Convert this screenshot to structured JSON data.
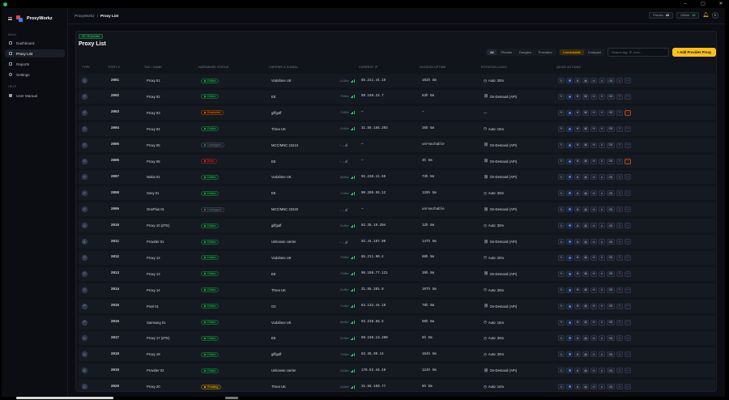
{
  "app": {
    "brand": "ProxyWorkz"
  },
  "window": {
    "controls": [
      "–",
      "▢",
      "✕"
    ]
  },
  "sidebar": {
    "main_label": "MAIN",
    "help_label": "HELP",
    "items": [
      {
        "label": "Dashboard",
        "icon": "grid-icon"
      },
      {
        "label": "Proxy List",
        "icon": "link-icon"
      },
      {
        "label": "Reports",
        "icon": "chart-icon"
      },
      {
        "label": "Settings",
        "icon": "gear-icon"
      }
    ],
    "help_items": [
      {
        "label": "User Manual",
        "icon": "book-icon"
      }
    ]
  },
  "topbar": {
    "breadcrumb_root": "ProxyWorkz",
    "breadcrumb_sep": "/",
    "breadcrumb_current": "Proxy List",
    "proxies_label": "Proxies",
    "proxies_count": "20",
    "online_label": "Online",
    "online_count": "15",
    "avatar": "D"
  },
  "panel": {
    "badge": "20 / 20 proxies",
    "title": "Proxy List",
    "filters": [
      "All",
      "Phones",
      "Dongles",
      "Providers"
    ],
    "density": [
      "Comfortable",
      "Compact"
    ],
    "search_placeholder": "Search tag, IP, host...",
    "add_button": "+ Add Provider Proxy"
  },
  "columns": [
    "TYPE",
    "PORT #",
    "TAG / NAME",
    "HARDWARE STATUS",
    "CARRIER & SIGNAL",
    "CURRENT IP",
    "SESSION UPTIME",
    "ROTATION LOGIC",
    "QUICK ACTIONS"
  ],
  "colors": {
    "online": "#22c55e",
    "restricted": "#f97316",
    "error": "#ef4444",
    "unplugged": "#6b7280",
    "rotating": "#fbbf24",
    "accent": "#fbbf24"
  },
  "rows": [
    {
      "type": "D",
      "port": "2001",
      "name": "Proxy 01",
      "status": "Online",
      "carrier": "Vodafone UK",
      "signal": "-61dBm",
      "ip": "85.211.44.19",
      "uptime": "102h 5m",
      "rotation": "Auto: 30m",
      "rot_icon": "timer-icon"
    },
    {
      "type": "D",
      "port": "2002",
      "name": "Proxy 02",
      "status": "Online",
      "carrier": "EE",
      "signal": "-79dBm",
      "ip": "90.198.22.7",
      "uptime": "63h 5m",
      "rotation": "On-Demand (API)",
      "rot_icon": "link-icon"
    },
    {
      "type": "D",
      "port": "2003",
      "name": "Proxy 03",
      "status": "Restricted",
      "carrier": "giffgaff",
      "signal": "-71dBm",
      "ip": "—",
      "uptime": "—",
      "rotation": "—",
      "rot_icon": ""
    },
    {
      "type": "D",
      "port": "2004",
      "name": "Proxy 04",
      "status": "Online",
      "carrier": "Three UK",
      "signal": "-91dBm",
      "ip": "31.55.184.203",
      "uptime": "26h 5m",
      "rotation": "Auto: 15m",
      "rot_icon": "timer-icon"
    },
    {
      "type": "D",
      "port": "2005",
      "name": "Proxy 05",
      "status": "Unplugged",
      "carrier": "MCC/MNC 23410",
      "signal": "—",
      "ip": "—",
      "uptime": "unreachable",
      "rotation": "On-Demand (API)",
      "rot_icon": "link-icon"
    },
    {
      "type": "D",
      "port": "2006",
      "name": "Proxy 06",
      "status": "Error",
      "carrier": "EE",
      "signal": "—",
      "ip": "—",
      "uptime": "3h 5m",
      "rotation": "On-Demand (API)",
      "rot_icon": "link-icon"
    },
    {
      "type": "P",
      "port": "2007",
      "name": "Nokia 01",
      "status": "Online",
      "carrier": "Vodafone UK",
      "signal": "-85dBm",
      "ip": "92.238.11.65",
      "uptime": "73h 5m",
      "rotation": "On-Demand (API)",
      "rot_icon": "link-icon"
    },
    {
      "type": "P",
      "port": "2008",
      "name": "Sony 01",
      "status": "Online",
      "carrier": "EE",
      "signal": "-71dBm",
      "ip": "90.205.55.12",
      "uptime": "129h 5m",
      "rotation": "Auto: 30m",
      "rot_icon": "timer-icon"
    },
    {
      "type": "P",
      "port": "2009",
      "name": "OnePlus 01",
      "status": "Unplugged",
      "carrier": "MCC/MNC 23420",
      "signal": "—",
      "ip": "—",
      "uptime": "unreachable",
      "rotation": "On-Demand (API)",
      "rot_icon": "link-icon"
    },
    {
      "type": "D",
      "port": "2010",
      "name": "Proxy 10 (ZTE)",
      "status": "Online",
      "carrier": "giffgaff",
      "signal": "-91dBm",
      "ip": "82.35.19.204",
      "uptime": "12h 5m",
      "rotation": "Auto: 30m",
      "rot_icon": "timer-icon"
    },
    {
      "type": "E",
      "port": "2011",
      "name": "Provider 01",
      "status": "Online",
      "carrier": "Unknown carrier",
      "signal": "—",
      "ip": "92.44.187.90",
      "uptime": "147h 5m",
      "rotation": "On-Demand (API)",
      "rot_icon": "link-icon"
    },
    {
      "type": "D",
      "port": "2012",
      "name": "Proxy 12",
      "status": "Online",
      "carrier": "Vodafone UK",
      "signal": "-79dBm",
      "ip": "85.211.90.4",
      "uptime": "60h 5m",
      "rotation": "Auto: 20m",
      "rot_icon": "timer-icon"
    },
    {
      "type": "D",
      "port": "2013",
      "name": "Proxy 13",
      "status": "Online",
      "carrier": "EE",
      "signal": "-79dBm",
      "ip": "90.198.77.121",
      "uptime": "39h 5m",
      "rotation": "On-Demand (API)",
      "rot_icon": "link-icon"
    },
    {
      "type": "D",
      "port": "2014",
      "name": "Proxy 14",
      "status": "Online",
      "carrier": "Three UK",
      "signal": "-61dBm",
      "ip": "31.55.201.9",
      "uptime": "107h 5m",
      "rotation": "Auto: 30m",
      "rot_icon": "timer-icon"
    },
    {
      "type": "P",
      "port": "2015",
      "name": "Pixel 01",
      "status": "Online",
      "carrier": "O2",
      "signal": "-71dBm",
      "ip": "82.132.44.18",
      "uptime": "78h 5m",
      "rotation": "On-Demand (API)",
      "rot_icon": "link-icon"
    },
    {
      "type": "P",
      "port": "2016",
      "name": "Samsung 01",
      "status": "Online",
      "carrier": "Vodafone UK",
      "signal": "-86dBm",
      "ip": "92.238.66.5",
      "uptime": "50h 5m",
      "rotation": "Auto: 15m",
      "rot_icon": "timer-icon"
    },
    {
      "type": "D",
      "port": "2017",
      "name": "Proxy 17 (ZTE)",
      "status": "Online",
      "carrier": "EE",
      "signal": "-91dBm",
      "ip": "90.198.13.200",
      "uptime": "9h 5m",
      "rotation": "Auto: 30m",
      "rot_icon": "timer-icon"
    },
    {
      "type": "D",
      "port": "2018",
      "name": "Proxy 18",
      "status": "Online",
      "carrier": "giffgaff",
      "signal": "-79dBm",
      "ip": "82.35.99.14",
      "uptime": "164h 5m",
      "rotation": "Auto: 30m",
      "rot_icon": "timer-icon"
    },
    {
      "type": "E",
      "port": "2019",
      "name": "Provider 02",
      "status": "Online",
      "carrier": "Unknown carrier",
      "signal": "-64dBm",
      "ip": "178.62.44.19",
      "uptime": "124h 5m",
      "rotation": "On-Demand (API)",
      "rot_icon": "link-icon"
    },
    {
      "type": "D",
      "port": "2020",
      "name": "Proxy 20",
      "status": "Rotating",
      "carrier": "Three UK",
      "signal": "-64dBm",
      "ip": "31.55.150.77",
      "uptime": "8h 5m",
      "rotation": "Auto: 10m",
      "rot_icon": "timer-icon"
    }
  ],
  "actions": {
    "refresh": "↻",
    "settings": "⚙",
    "copy": "▤",
    "mail": "✉",
    "hash": "#",
    "gb": "GB",
    "kill": "✎",
    "more": "⋯"
  }
}
